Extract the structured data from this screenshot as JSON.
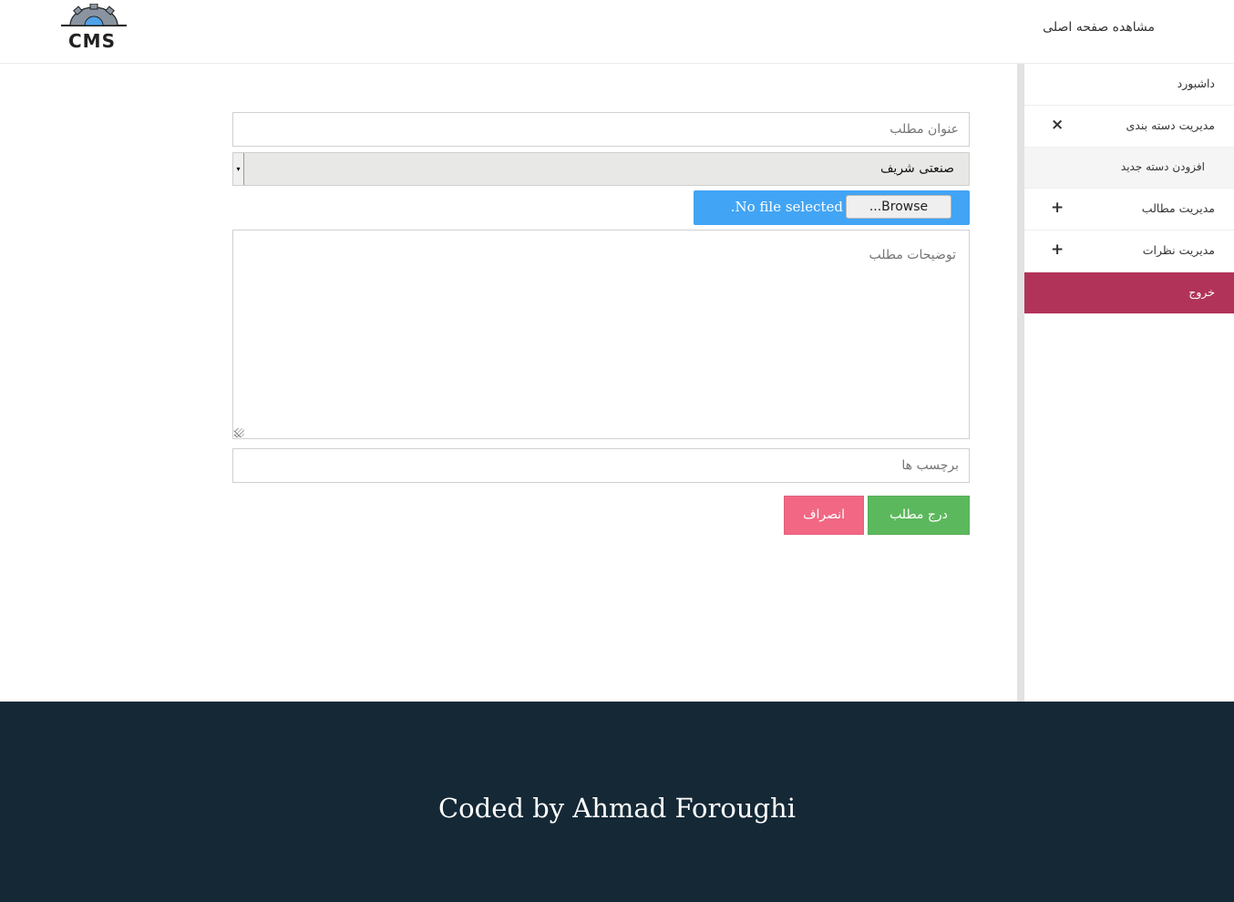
{
  "header": {
    "logo_text": "CMS",
    "home_link": "مشاهده صفحه اصلی"
  },
  "sidebar": {
    "items": [
      {
        "label": "داشبورد"
      },
      {
        "label": "مدیریت دسته بندی",
        "sign": "×"
      },
      {
        "label": "افزودن دسته جدید"
      },
      {
        "label": "مدیریت مطالب",
        "sign": "+"
      },
      {
        "label": "مدیریت نظرات",
        "sign": "+"
      },
      {
        "label": "خروج"
      }
    ]
  },
  "form": {
    "title_placeholder": "عنوان مطلب",
    "category_selected": "صنعتی شریف",
    "file_browse_label": "...Browse",
    "file_status": ".No file selected",
    "description_placeholder": "توضیحات مطلب",
    "tags_placeholder": "برچسب ها",
    "submit_label": "درج مطلب",
    "cancel_label": "انصراف"
  },
  "footer": {
    "credit": "Coded by Ahmad Foroughi"
  },
  "colors": {
    "exit_bg": "#b2335a",
    "file_bar": "#42a4f4",
    "submit_bg": "#5cb85c",
    "cancel_bg": "#f16784",
    "footer_bg": "#142836"
  }
}
